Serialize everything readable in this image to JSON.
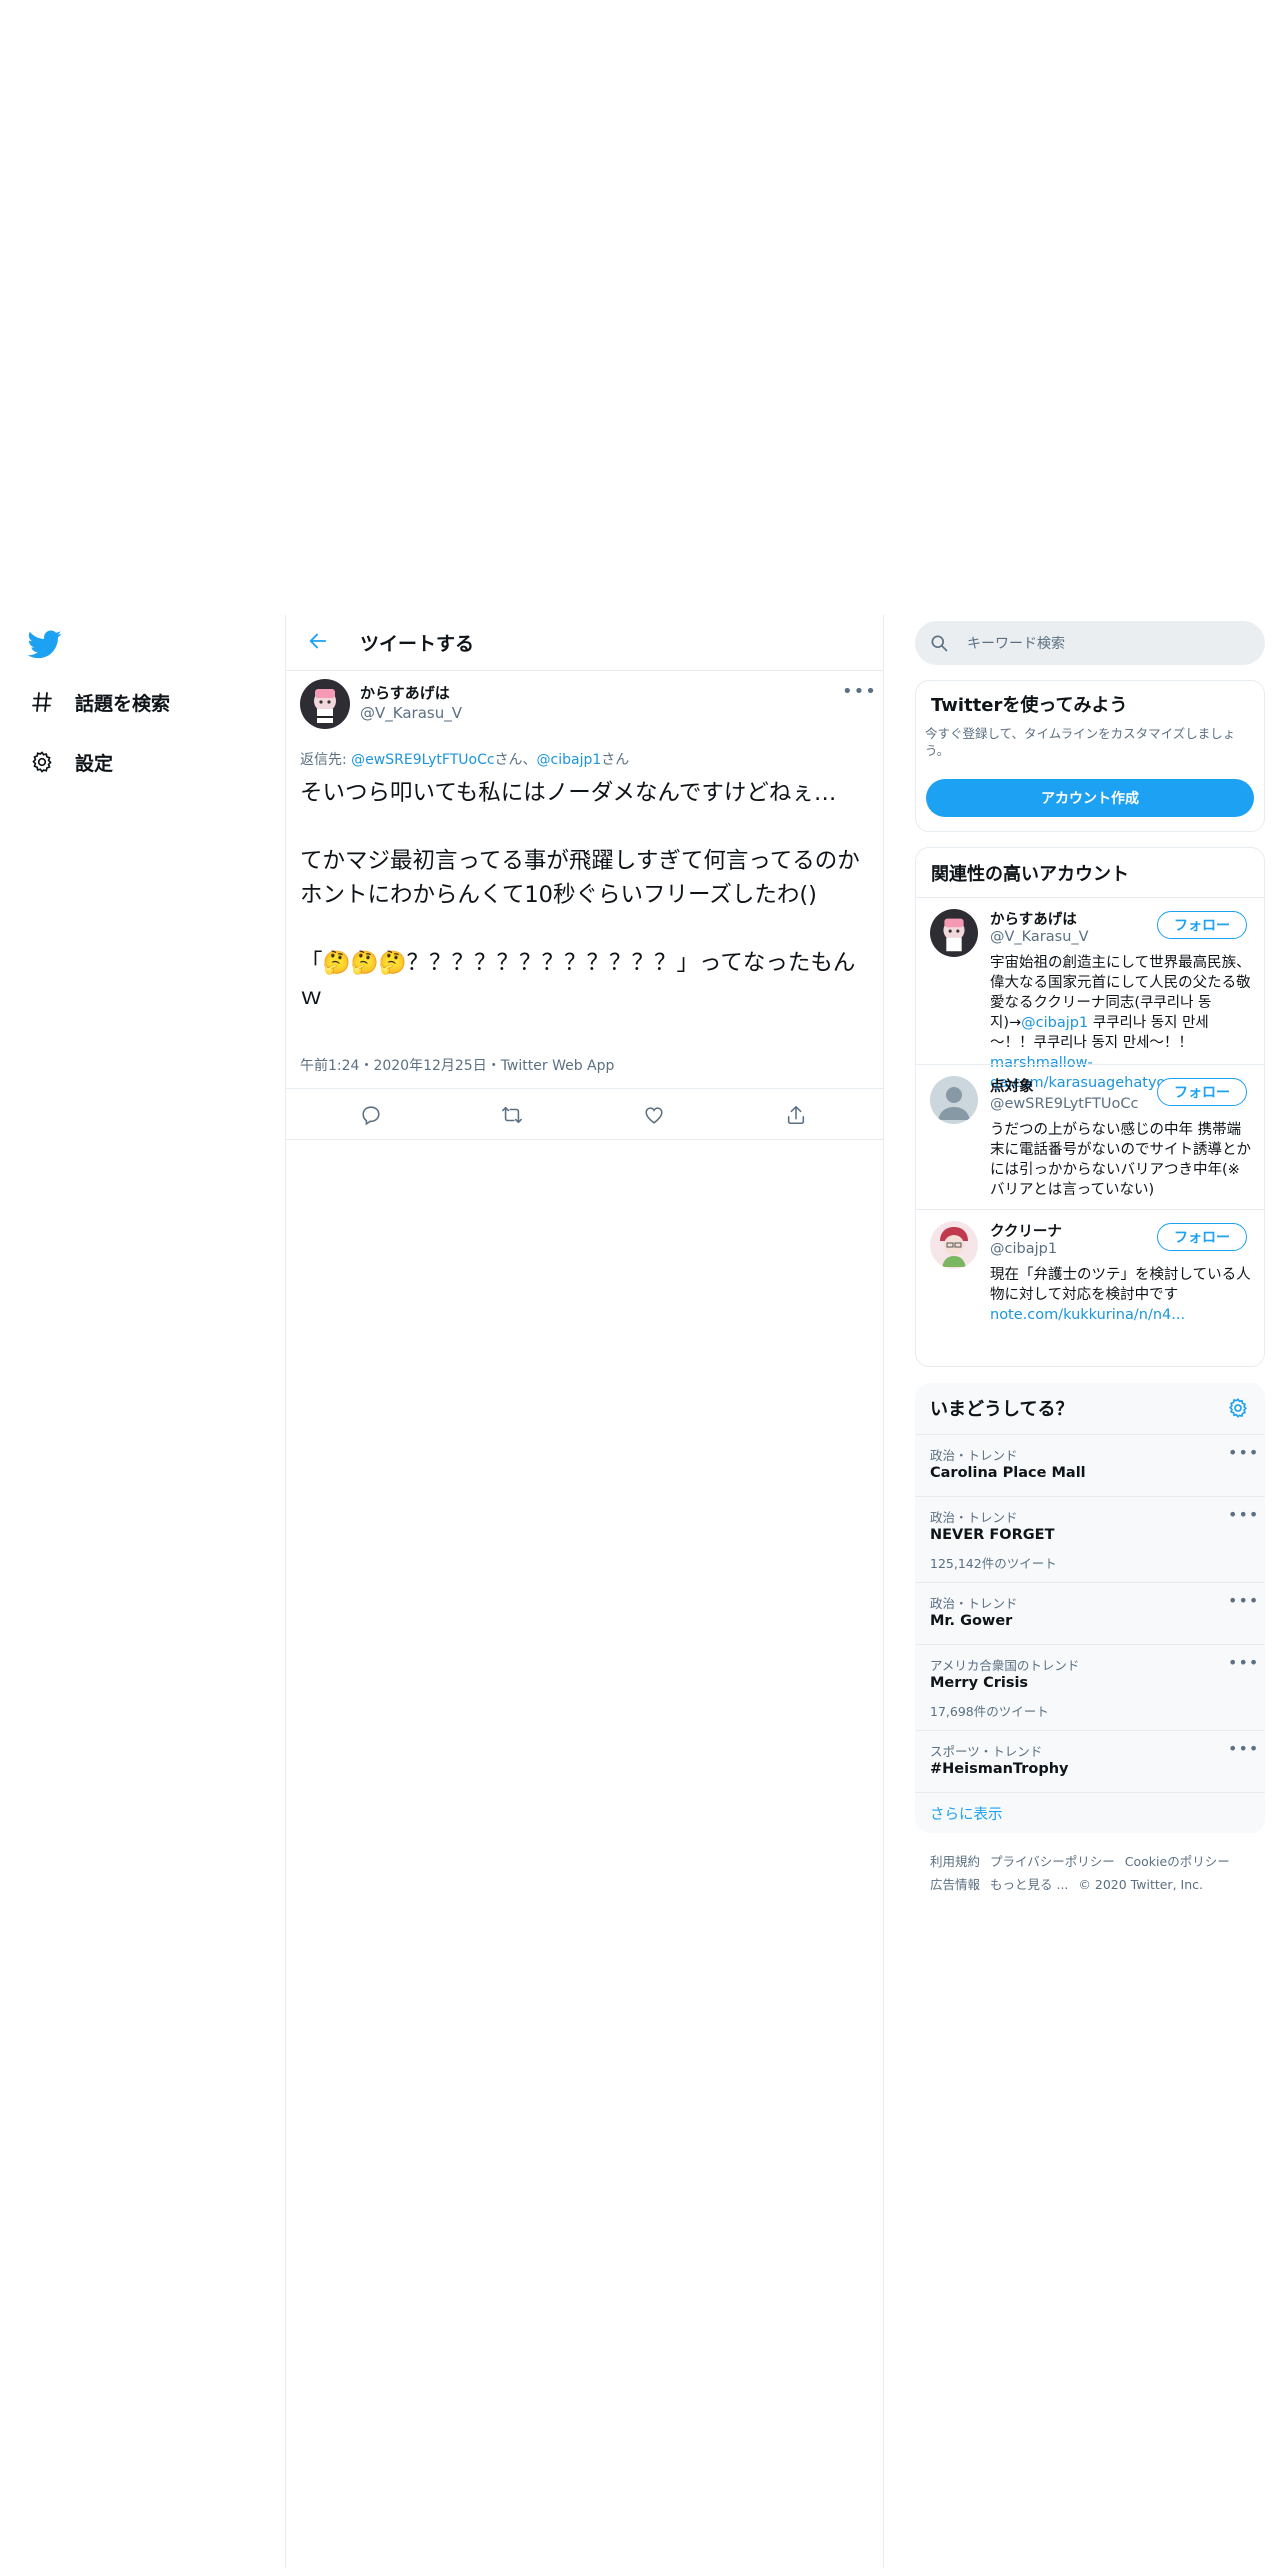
{
  "colors": {
    "accent": "#1da1f2",
    "link": "#1b95e0",
    "muted": "#5b7083",
    "divider": "#e6ecf0"
  },
  "nav": {
    "logo": "twitter-bird-icon",
    "items": [
      {
        "label": "話題を検索",
        "icon": "hashtag-icon"
      },
      {
        "label": "設定",
        "icon": "gear-icon"
      }
    ]
  },
  "header": {
    "title": "ツイートする",
    "back_icon": "back-arrow-icon"
  },
  "tweet": {
    "name": "からすあげは",
    "handle": "@V_Karasu_V",
    "more": "•••",
    "reply_prefix": "返信先: ",
    "reply_user1": "@ewSRE9LytFTUoCc",
    "reply_mid": "さん、",
    "reply_user2": "@cibajp1",
    "reply_suffix": "さん",
    "text": "そいつら叩いても私にはノーダメなんですけどねぇ…\n\nてかマジ最初言ってる事が飛躍しすぎて何言ってるのかホントにわからんくて10秒ぐらいフリーズしたわ()\n\n「🤔🤔🤔？？？？？？？？？？？？」ってなったもんｗ",
    "meta": "午前1:24・2020年12月25日・Twitter Web App",
    "actions": [
      "reply-icon",
      "retweet-icon",
      "like-icon",
      "share-icon"
    ]
  },
  "search": {
    "placeholder": "キーワード検索"
  },
  "signup": {
    "title": "Twitterを使ってみよう",
    "subtitle": "今すぐ登録して、タイムラインをカスタマイズしましょう。",
    "button": "アカウント作成"
  },
  "related": {
    "title": "関連性の高いアカウント",
    "follow_label": "フォロー",
    "accounts": [
      {
        "name": "からすあげは",
        "handle": "@V_Karasu_V",
        "bio_a": "宇宙始祖の創造主にして世界最高民族、偉大なる国家元首にして人民の父たる敬愛なるククリーナ同志(쿠쿠리나 동지)→",
        "bio_link": "@cibajp1",
        "bio_b": " 쿠쿠리나 동지 만세～！！쿠쿠리나 동지 만세～！！",
        "bio_url": "marshmallow-qa.com/karasuagehatyo..."
      },
      {
        "name": "点対象",
        "handle": "@ewSRE9LytFTUoCc",
        "bio_a": "うだつの上がらない感じの中年 携帯端末に電話番号がないのでサイト誘導とかには引っかからないバリアつき中年(※バリアとは言っていない)"
      },
      {
        "name": "ククリーナ",
        "handle": "@cibajp1",
        "bio_a": "現在「弁護士のツテ」を検討している人物に対して対応を検討中です",
        "bio_url": "note.com/kukkurina/n/n4..."
      }
    ]
  },
  "trends": {
    "title": "いまどうしてる？",
    "items": [
      {
        "category": "政治・トレンド",
        "name": "Carolina Place Mall"
      },
      {
        "category": "政治・トレンド",
        "name": "NEVER FORGET",
        "count": "125,142件のツイート"
      },
      {
        "category": "政治・トレンド",
        "name": "Mr. Gower"
      },
      {
        "category": "アメリカ合衆国のトレンド",
        "name": "Merry Crisis",
        "count": "17,698件のツイート"
      },
      {
        "category": "スポーツ・トレンド",
        "name": "#HeismanTrophy"
      }
    ],
    "more_dots": "•••",
    "show_more": "さらに表示"
  },
  "footer": {
    "links": [
      "利用規約",
      "プライバシーポリシー",
      "Cookieのポリシー",
      "広告情報",
      "もっと見る ..."
    ],
    "copyright": "© 2020 Twitter, Inc."
  }
}
